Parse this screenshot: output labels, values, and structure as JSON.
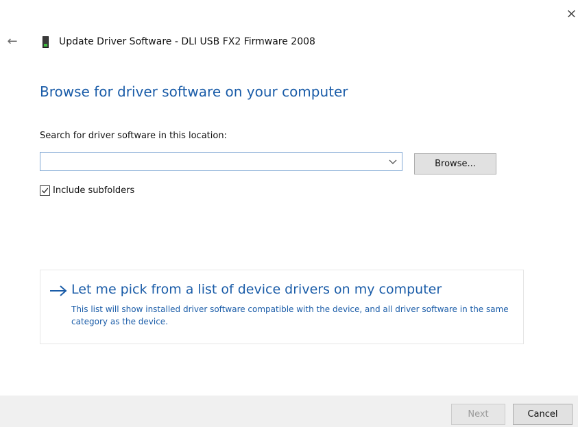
{
  "window": {
    "title": "Update Driver Software - DLI USB FX2 Firmware 2008",
    "close_glyph": "×",
    "back_glyph": "←",
    "device_icon": "usb-device-icon"
  },
  "main": {
    "heading": "Browse for driver software on your computer",
    "search_label": "Search for driver software in this location:",
    "location_value": "",
    "location_placeholder": "",
    "browse_label": "Browse...",
    "include_subfolders_label": "Include subfolders",
    "include_subfolders_checked": true
  },
  "pick_option": {
    "arrow_icon": "arrow-right-icon",
    "title": "Let me pick from a list of device drivers on my computer",
    "description": "This list will show installed driver software compatible with the device, and all driver software in the same category as the device."
  },
  "footer": {
    "next_label": "Next",
    "next_enabled": false,
    "cancel_label": "Cancel"
  },
  "colors": {
    "heading_blue": "#1a5ca8",
    "footer_bg": "#f0f0f0",
    "button_bg": "#e1e1e1"
  }
}
